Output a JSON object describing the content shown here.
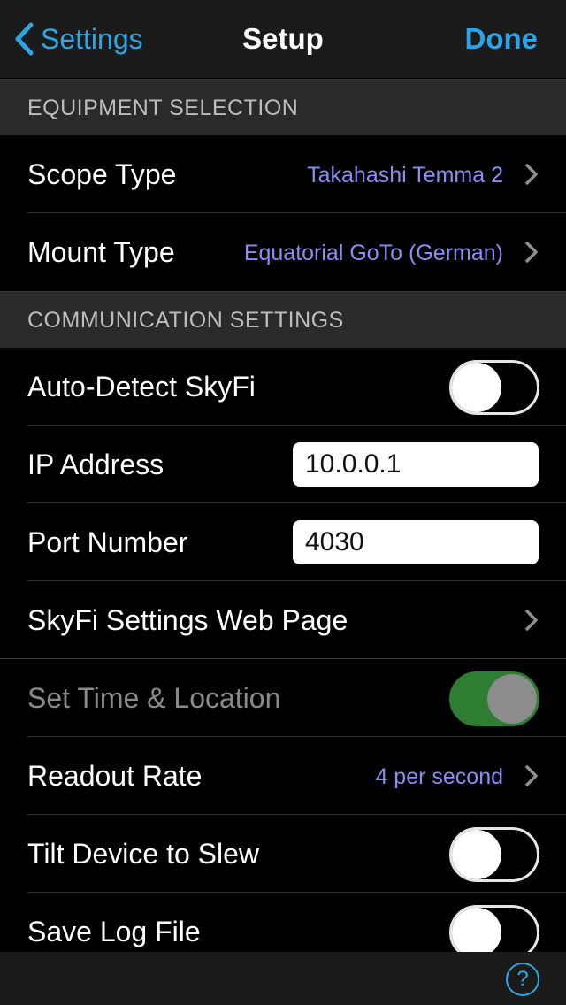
{
  "navbar": {
    "back_label": "Settings",
    "title": "Setup",
    "done_label": "Done"
  },
  "sections": {
    "equipment": "EQUIPMENT SELECTION",
    "communication": "COMMUNICATION SETTINGS"
  },
  "equipment": {
    "scope_type": {
      "label": "Scope Type",
      "value": "Takahashi Temma 2"
    },
    "mount_type": {
      "label": "Mount Type",
      "value": "Equatorial GoTo (German)"
    }
  },
  "communication": {
    "auto_detect": {
      "label": "Auto-Detect SkyFi",
      "on": false
    },
    "ip_address": {
      "label": "IP Address",
      "value": "10.0.0.1"
    },
    "port_number": {
      "label": "Port Number",
      "value": "4030"
    },
    "web_page": {
      "label": "SkyFi Settings Web Page"
    }
  },
  "other": {
    "set_time": {
      "label": "Set Time & Location",
      "on": true,
      "disabled": true
    },
    "readout_rate": {
      "label": "Readout Rate",
      "value": "4 per second"
    },
    "tilt_device": {
      "label": "Tilt Device to Slew",
      "on": false
    },
    "save_log": {
      "label": "Save Log File",
      "on": false
    }
  },
  "bottombar": {
    "help_label": "?"
  },
  "colors": {
    "accent": "#2ca5e6",
    "value_text": "#8a8ef0",
    "toggle_on": "#2e7d32"
  }
}
